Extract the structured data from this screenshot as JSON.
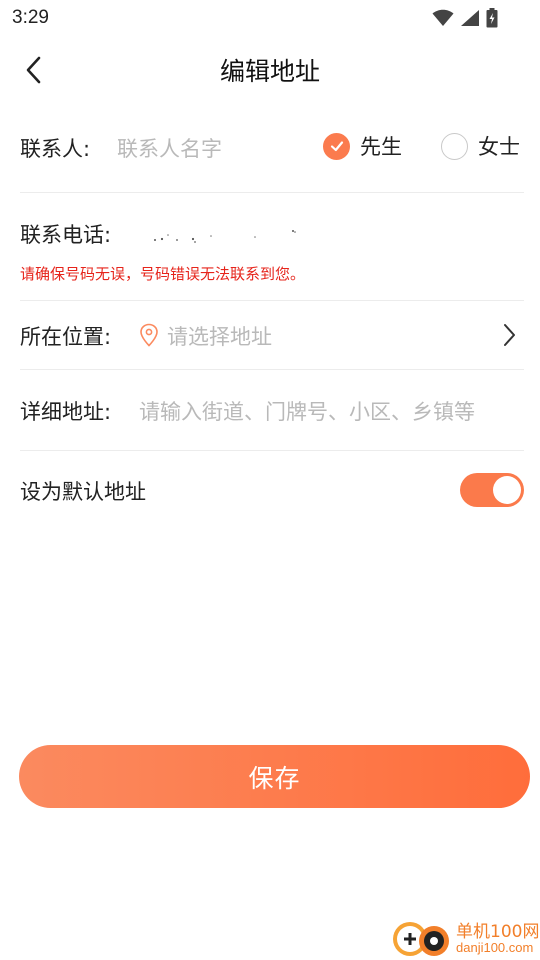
{
  "status_bar": {
    "time": "3:29",
    "icons": [
      "wifi-icon",
      "signal-icon",
      "battery-icon"
    ]
  },
  "header": {
    "back_icon": "back-arrow-icon",
    "title": "编辑地址"
  },
  "contact": {
    "label": "联系人:",
    "placeholder": "联系人名字",
    "gender_options": [
      {
        "label": "先生",
        "selected": true
      },
      {
        "label": "女士",
        "selected": false
      }
    ]
  },
  "phone": {
    "label": "联系电话:",
    "value": "",
    "warning": "请确保号码无误，号码错误无法联系到您。"
  },
  "location": {
    "label": "所在位置:",
    "placeholder": "请选择地址",
    "icon": "location-pin-icon",
    "chevron": "chevron-right-icon"
  },
  "detail_address": {
    "label": "详细地址:",
    "placeholder": "请输入街道、门牌号、小区、乡镇等"
  },
  "default_address": {
    "label": "设为默认地址",
    "enabled": true
  },
  "save_button": {
    "label": "保存"
  },
  "watermark": {
    "name": "单机100网",
    "url": "danji100.com"
  },
  "colors": {
    "accent": "#fb7b4e",
    "warning": "#e6241b",
    "placeholder": "#b9b9b9",
    "divider": "#ececec"
  }
}
